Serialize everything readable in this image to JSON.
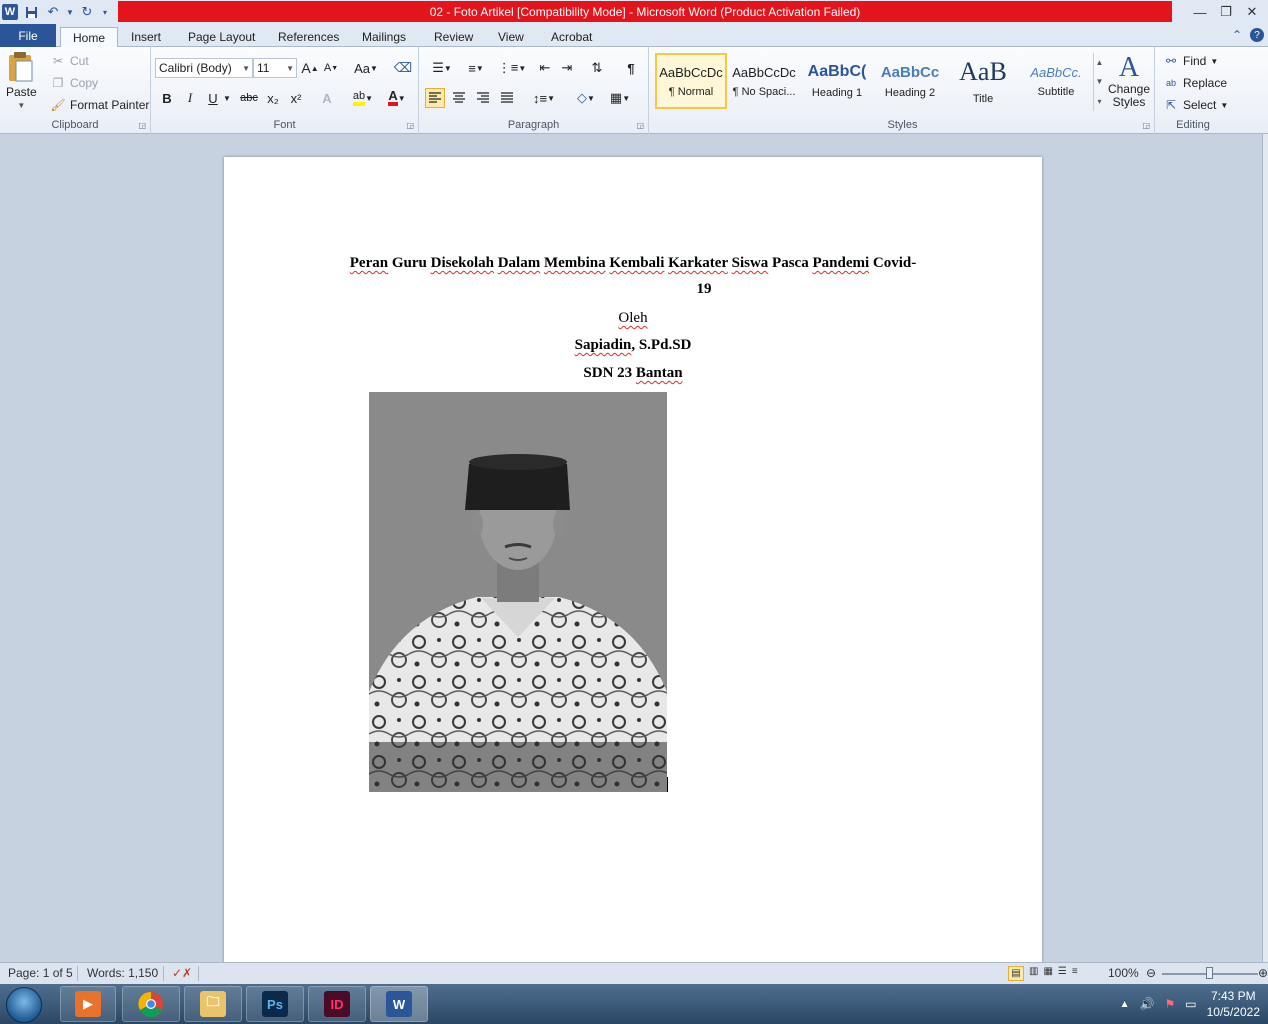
{
  "window": {
    "title": "02 - Foto Artikel [Compatibility Mode]  -  Microsoft Word (Product Activation Failed)",
    "app_letter": "W"
  },
  "tabs": [
    "File",
    "Home",
    "Insert",
    "Page Layout",
    "References",
    "Mailings",
    "Review",
    "View",
    "Acrobat"
  ],
  "clipboard": {
    "paste": "Paste",
    "cut": "Cut",
    "copy": "Copy",
    "format_painter": "Format Painter",
    "label": "Clipboard"
  },
  "font": {
    "family": "Calibri (Body)",
    "size": "11",
    "change_case": "Aa",
    "label": "Font",
    "bold": "B",
    "italic": "I",
    "underline": "U",
    "strikethrough": "abc",
    "subscript": "x₂",
    "superscript": "x²",
    "grow": "A",
    "shrink": "A",
    "highlight": "ab",
    "color": "A"
  },
  "paragraph": {
    "label": "Paragraph",
    "show_marks": "¶"
  },
  "styles": {
    "label": "Styles",
    "items": [
      {
        "preview": "AaBbCcDc",
        "name": "¶ Normal"
      },
      {
        "preview": "AaBbCcDc",
        "name": "¶ No Spaci..."
      },
      {
        "preview": "AaBbC(",
        "name": "Heading 1"
      },
      {
        "preview": "AaBbCc",
        "name": "Heading 2"
      },
      {
        "preview": "AaB",
        "name": "Title"
      },
      {
        "preview": "AaBbCc.",
        "name": "Subtitle"
      }
    ],
    "change_styles": "Change Styles"
  },
  "editing": {
    "find": "Find",
    "replace": "Replace",
    "select": "Select",
    "label": "Editing"
  },
  "document": {
    "title_words": [
      "Peran",
      "Guru",
      "Disekolah",
      "Dalam",
      "Membina",
      "Kembali",
      "Karkater",
      "Siswa",
      "Pasca",
      "Pandemi",
      "Covid-"
    ],
    "title_line2": "19",
    "by": "Oleh",
    "author_name": "Sapiadin",
    "author_degree": ", S.Pd.SD",
    "school_prefix": "SDN 23 ",
    "school_name": "Bantan"
  },
  "status": {
    "page": "Page: 1 of 5",
    "words": "Words: 1,150",
    "zoom": "100%",
    "zoom_value_percent": 100
  },
  "taskbar": {
    "apps": [
      "Media",
      "Chrome",
      "Explorer",
      "Ps",
      "ID",
      "W"
    ],
    "time": "7:43 PM",
    "date": "10/5/2022"
  },
  "colors": {
    "title_red": "#e3141c",
    "file_tab": "#2a5699",
    "word_blue": "#2b579a",
    "spell_red": "#e12a2a"
  }
}
